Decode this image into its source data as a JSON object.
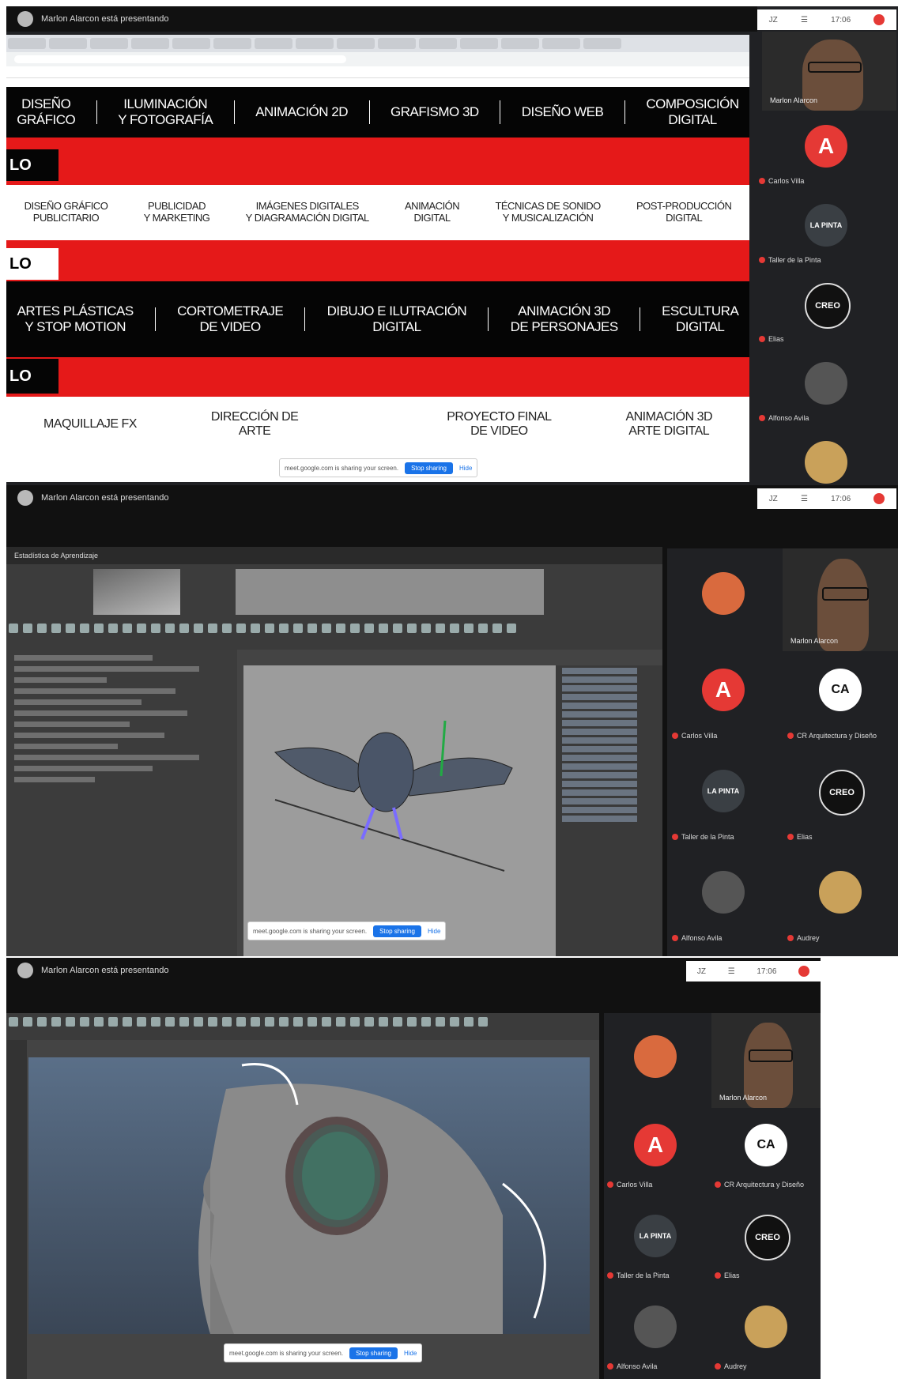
{
  "presenter_banner": "Marlon Alarcon está presentando",
  "status": {
    "left_label": "JZ",
    "time1": "17:06",
    "time2": "17:06",
    "time3": "17:06"
  },
  "panel1": {
    "row1": [
      "DISEÑO\nGRÁFICO",
      "ILUMINACIÓN\nY FOTOGRAFÍA",
      "ANIMACIÓN 2D",
      "GRAFISMO 3D",
      "DISEÑO WEB",
      "COMPOSICIÓN\nDIGITAL"
    ],
    "tag": "LO",
    "row2": [
      "DISEÑO GRÁFICO\nPUBLICITARIO",
      "PUBLICIDAD\nY MARKETING",
      "IMÁGENES DIGITALES\nY DIAGRAMACIÓN DIGITAL",
      "ANIMACIÓN\nDIGITAL",
      "TÉCNICAS DE SONIDO\nY MUSICALIZACIÓN",
      "POST-PRODUCCIÓN\nDIGITAL"
    ],
    "row3": [
      "ARTES PLÁSTICAS\nY STOP MOTION",
      "CORTOMETRAJE\nDE VIDEO",
      "DIBUJO E ILUTRACIÓN\nDIGITAL",
      "ANIMACIÓN 3D\nDE PERSONAJES",
      "ESCULTURA\nDIGITAL"
    ],
    "row4": [
      "MAQUILLAJE FX",
      "DIRECCIÓN DE\nARTE",
      "",
      "PROYECTO FINAL\nDE VIDEO",
      "ANIMACIÓN 3D\nARTE DIGITAL"
    ],
    "share_text": "meet.google.com is sharing your screen.",
    "stop_label": "Stop sharing",
    "hide_label": "Hide",
    "participants": [
      {
        "name": "Marlon Alarcon",
        "label": ""
      },
      {
        "name": "Carlos Villa",
        "label": "A"
      },
      {
        "name": "Taller de la Pinta",
        "label": "LA PINTA"
      },
      {
        "name": "Elias",
        "label": "CREO"
      },
      {
        "name": "Alfonso Avila",
        "label": ""
      },
      {
        "name": "",
        "label": ""
      }
    ]
  },
  "panel2": {
    "maya_title": "Estadística de Aprendizaje",
    "share_text": "meet.google.com is sharing your screen.",
    "stop_label": "Stop sharing",
    "hide_label": "Hide",
    "participants": [
      {
        "name": "Marlon Alarcon",
        "label": ""
      },
      {
        "name": "Carlos Villa",
        "label": "A"
      },
      {
        "name": "CR Arquitectura y Diseño",
        "label": "CA"
      },
      {
        "name": "Taller de la Pinta",
        "label": "LA PINTA"
      },
      {
        "name": "Elias",
        "label": "CREO"
      },
      {
        "name": "Alfonso Avila",
        "label": ""
      },
      {
        "name": "Audrey",
        "label": ""
      }
    ]
  },
  "panel3": {
    "share_text": "meet.google.com is sharing your screen.",
    "stop_label": "Stop sharing",
    "hide_label": "Hide",
    "participants": [
      {
        "name": "Marlon Alarcon",
        "label": ""
      },
      {
        "name": "Carlos Villa",
        "label": "A"
      },
      {
        "name": "CR Arquitectura y Diseño",
        "label": "CA"
      },
      {
        "name": "Taller de la Pinta",
        "label": "LA PINTA"
      },
      {
        "name": "Elias",
        "label": "CREO"
      },
      {
        "name": "Alfonso Avila",
        "label": ""
      },
      {
        "name": "Audrey",
        "label": ""
      }
    ]
  },
  "colors": {
    "red": "#e51919",
    "meet_bg": "#202124",
    "accent": "#1a73e8"
  }
}
